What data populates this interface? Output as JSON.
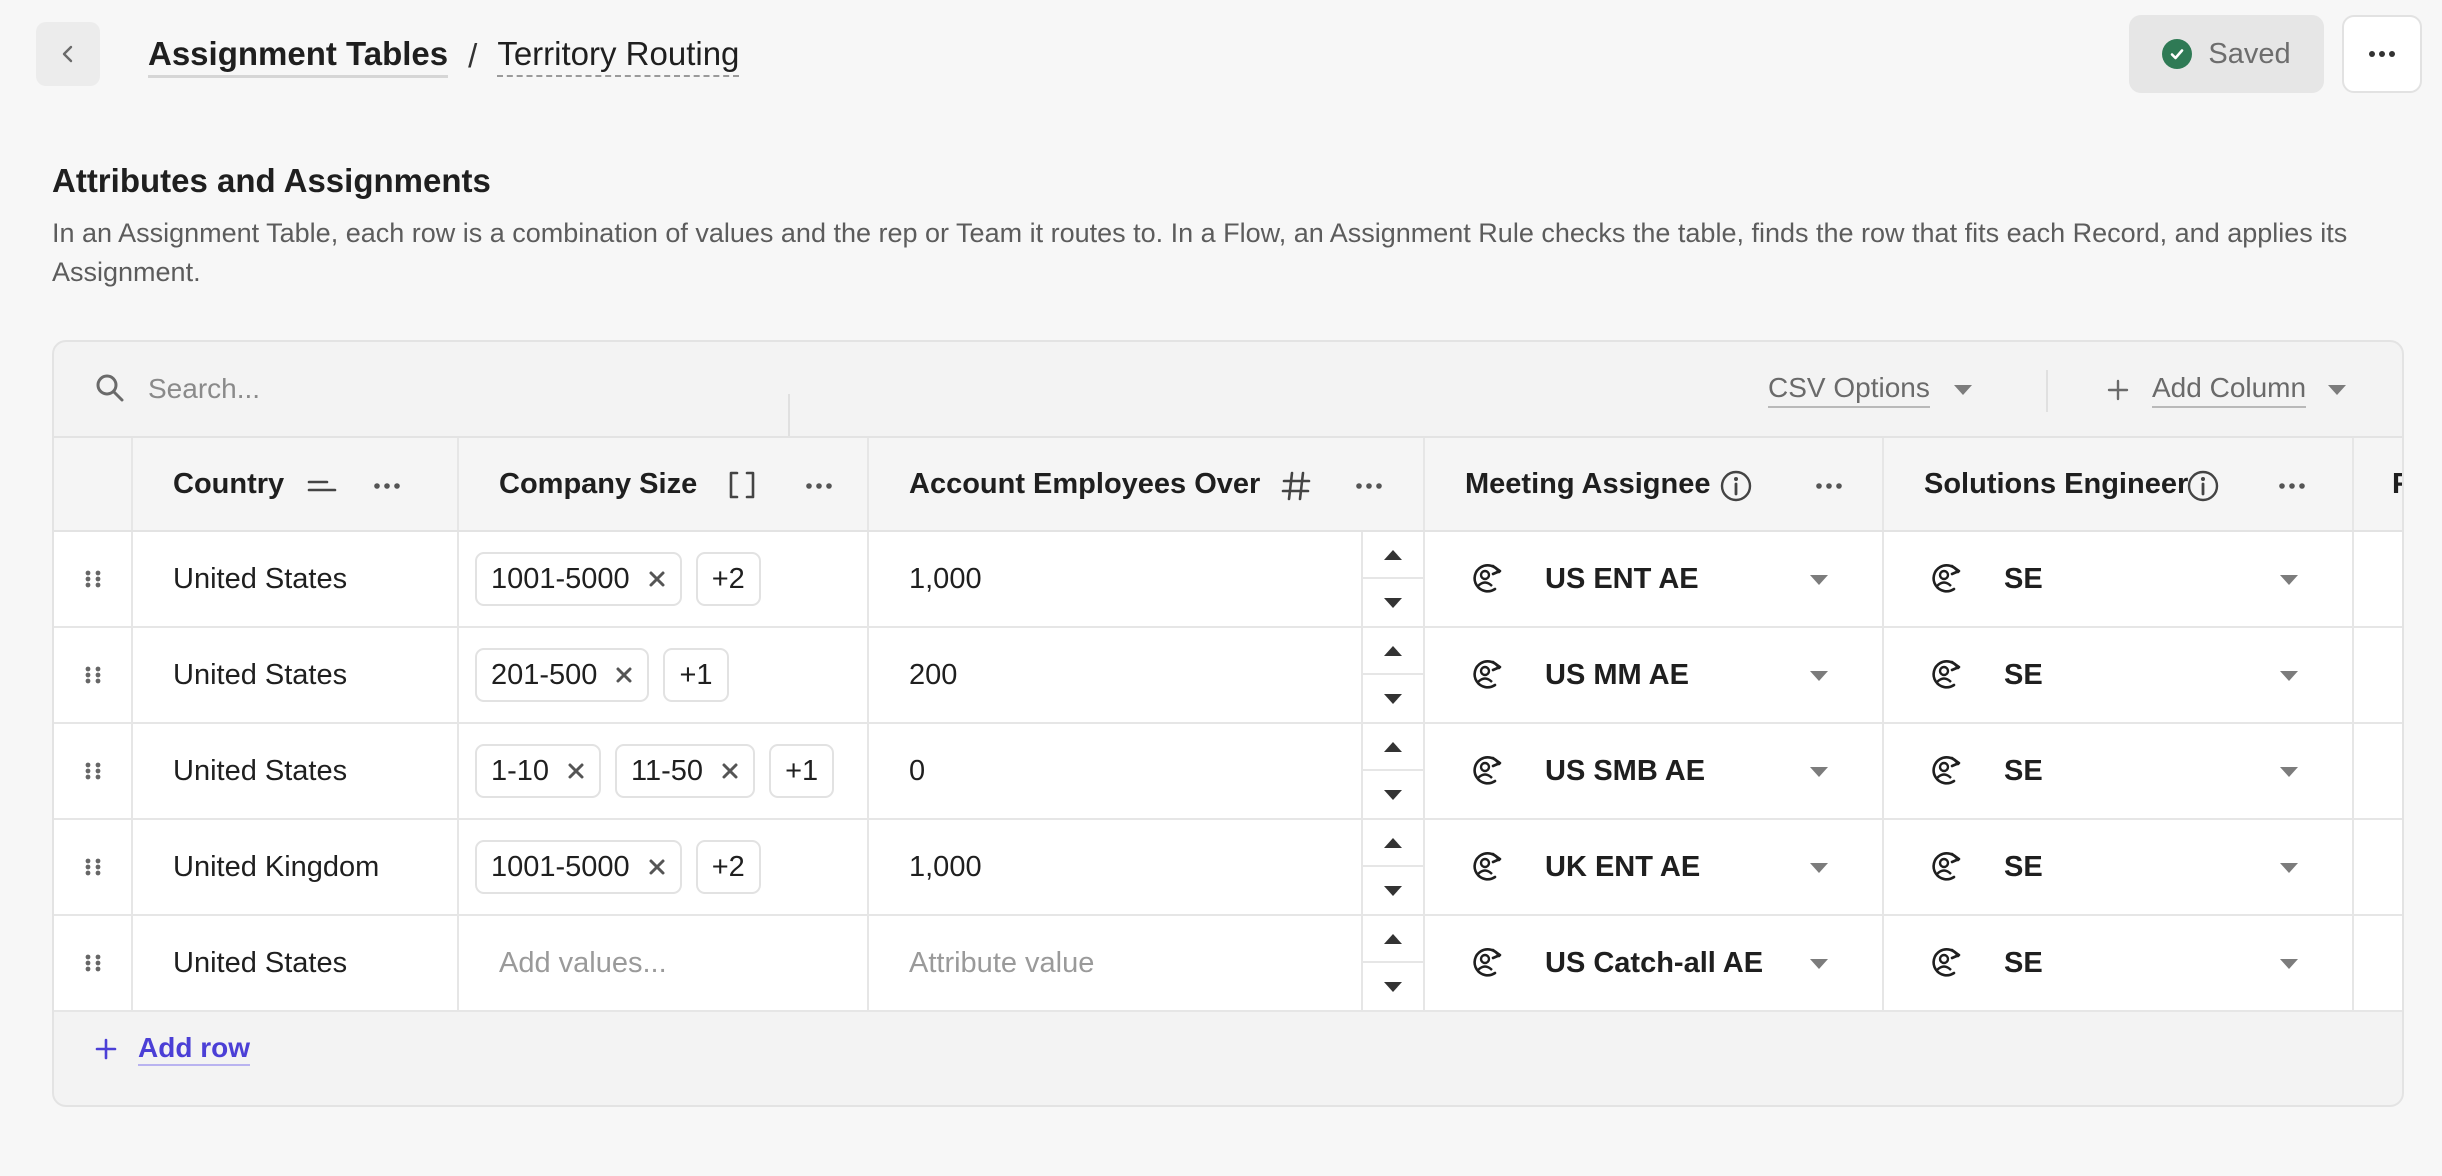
{
  "header": {
    "breadcrumb": [
      "Assignment Tables",
      "Territory Routing"
    ],
    "breadcrumb_separator": "/",
    "status_label": "Saved",
    "colors": {
      "saved_check": "#2f7a55",
      "link": "#4b3fd6"
    }
  },
  "section": {
    "title": "Attributes and Assignments",
    "description": "In an Assignment Table, each row is a combination of values and the rep or Team it routes to. In a Flow, an Assignment Rule checks the table, finds the row that fits each Record, and applies its Assignment."
  },
  "toolbar": {
    "search_placeholder": "Search...",
    "csv_label": "CSV Options",
    "add_column_label": "Add Column"
  },
  "columns": {
    "country": "Country",
    "company_size": "Company Size",
    "employees": "Account Employees Over",
    "meeting": "Meeting Assignee",
    "se": "Solutions Engineer",
    "next_partial": "F"
  },
  "rows": [
    {
      "country": "United States",
      "sizes": [
        "1001-5000"
      ],
      "more": "+2",
      "employees": "1,000",
      "meeting": "US ENT AE",
      "se": "SE"
    },
    {
      "country": "United States",
      "sizes": [
        "201-500"
      ],
      "more": "+1",
      "employees": "200",
      "meeting": "US MM AE",
      "se": "SE"
    },
    {
      "country": "United States",
      "sizes": [
        "1-10",
        "11-50"
      ],
      "more": "+1",
      "employees": "0",
      "meeting": "US SMB AE",
      "se": "SE"
    },
    {
      "country": "United Kingdom",
      "sizes": [
        "1001-5000"
      ],
      "more": "+2",
      "employees": "1,000",
      "meeting": "UK ENT AE",
      "se": "SE"
    },
    {
      "country": "United States",
      "sizes_placeholder": "Add values...",
      "employees_placeholder": "Attribute value",
      "meeting": "US Catch-all AE",
      "se": "SE"
    }
  ],
  "footer": {
    "add_row_label": "Add row"
  }
}
